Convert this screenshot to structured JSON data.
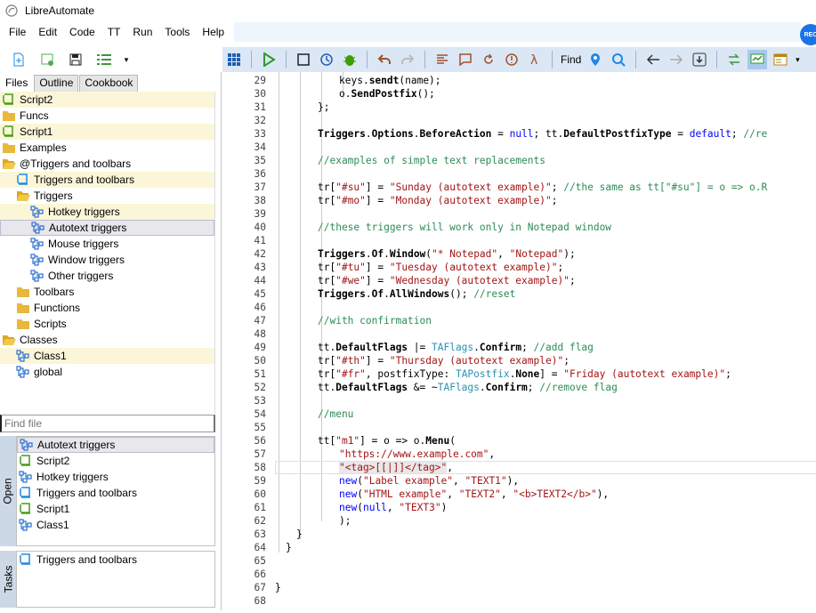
{
  "app": {
    "title": "LibreAutomate"
  },
  "menu": [
    "File",
    "Edit",
    "Code",
    "TT",
    "Run",
    "Tools",
    "Help"
  ],
  "toolbar": {
    "find_label": "Find"
  },
  "avatar_text": "REC",
  "tabs": [
    "Files",
    "Outline",
    "Cookbook"
  ],
  "files_tree": [
    {
      "label": "Script2",
      "indent": 0,
      "icon": "script-icon",
      "hl": true
    },
    {
      "label": "Funcs",
      "indent": 0,
      "icon": "folder-icon",
      "hl": false
    },
    {
      "label": "Script1",
      "indent": 0,
      "icon": "script-icon",
      "hl": true
    },
    {
      "label": "Examples",
      "indent": 0,
      "icon": "folder-icon",
      "hl": false
    },
    {
      "label": "@Triggers and toolbars",
      "indent": 0,
      "icon": "folder-open-icon",
      "hl": false
    },
    {
      "label": "Triggers and toolbars",
      "indent": 1,
      "icon": "script-blue-icon",
      "hl": true
    },
    {
      "label": "Triggers",
      "indent": 1,
      "icon": "folder-open-icon",
      "hl": false
    },
    {
      "label": "Hotkey triggers",
      "indent": 2,
      "icon": "class-icon",
      "hl": true
    },
    {
      "label": "Autotext triggers",
      "indent": 2,
      "icon": "class-icon",
      "sel": true
    },
    {
      "label": "Mouse triggers",
      "indent": 2,
      "icon": "class-icon",
      "hl": false
    },
    {
      "label": "Window triggers",
      "indent": 2,
      "icon": "class-icon",
      "hl": false
    },
    {
      "label": "Other triggers",
      "indent": 2,
      "icon": "class-icon",
      "hl": false
    },
    {
      "label": "Toolbars",
      "indent": 1,
      "icon": "folder-icon",
      "hl": false
    },
    {
      "label": "Functions",
      "indent": 1,
      "icon": "folder-icon",
      "hl": false
    },
    {
      "label": "Scripts",
      "indent": 1,
      "icon": "folder-icon",
      "hl": false
    },
    {
      "label": "Classes",
      "indent": 0,
      "icon": "folder-open-icon",
      "hl": false
    },
    {
      "label": "Class1",
      "indent": 1,
      "icon": "class-icon",
      "hl": true
    },
    {
      "label": "global",
      "indent": 1,
      "icon": "class-icon",
      "hl": false
    }
  ],
  "find_file_placeholder": "Find file",
  "open_label": "Open",
  "tasks_label": "Tasks",
  "open_files": [
    {
      "label": "Autotext triggers",
      "icon": "class-icon",
      "sel": true
    },
    {
      "label": "Script2",
      "icon": "script-icon"
    },
    {
      "label": "Hotkey triggers",
      "icon": "class-icon"
    },
    {
      "label": "Triggers and toolbars",
      "icon": "script-blue-icon"
    },
    {
      "label": "Script1",
      "icon": "script-icon"
    },
    {
      "label": "Class1",
      "icon": "class-icon"
    }
  ],
  "tasks": [
    {
      "label": "Triggers and toolbars",
      "icon": "script-blue-icon"
    }
  ],
  "code_lines": [
    {
      "n": "29",
      "ind": 3,
      "parts": [
        [
          "p",
          "keys."
        ],
        [
          "k",
          "sendt"
        ],
        [
          "p",
          "(name);"
        ]
      ]
    },
    {
      "n": "30",
      "ind": 3,
      "parts": [
        [
          "p",
          "o."
        ],
        [
          "k",
          "SendPostfix"
        ],
        [
          "p",
          "();"
        ]
      ]
    },
    {
      "n": "31",
      "ind": 2,
      "parts": [
        [
          "p",
          "};"
        ]
      ]
    },
    {
      "n": "32",
      "ind": 0,
      "parts": []
    },
    {
      "n": "33",
      "ind": 2,
      "parts": [
        [
          "k",
          "Triggers"
        ],
        [
          "p",
          "."
        ],
        [
          "k",
          "Options"
        ],
        [
          "p",
          "."
        ],
        [
          "k",
          "BeforeAction"
        ],
        [
          "p",
          " = "
        ],
        [
          "v",
          "null"
        ],
        [
          "p",
          "; tt."
        ],
        [
          "k",
          "DefaultPostfixType"
        ],
        [
          "p",
          " = "
        ],
        [
          "v",
          "default"
        ],
        [
          "p",
          "; "
        ],
        [
          "c",
          "//re"
        ]
      ]
    },
    {
      "n": "34",
      "ind": 0,
      "parts": []
    },
    {
      "n": "35",
      "ind": 2,
      "parts": [
        [
          "c",
          "//examples of simple text replacements"
        ]
      ]
    },
    {
      "n": "36",
      "ind": 0,
      "parts": []
    },
    {
      "n": "37",
      "ind": 2,
      "parts": [
        [
          "p",
          "tr["
        ],
        [
          "s",
          "\"#su\""
        ],
        [
          "p",
          "] = "
        ],
        [
          "s",
          "\"Sunday (autotext example)\""
        ],
        [
          "p",
          "; "
        ],
        [
          "c",
          "//the same as tt[\"#su\"] = o => o.R"
        ]
      ]
    },
    {
      "n": "38",
      "ind": 2,
      "parts": [
        [
          "p",
          "tr["
        ],
        [
          "s",
          "\"#mo\""
        ],
        [
          "p",
          "] = "
        ],
        [
          "s",
          "\"Monday (autotext example)\""
        ],
        [
          "p",
          ";"
        ]
      ]
    },
    {
      "n": "39",
      "ind": 0,
      "parts": []
    },
    {
      "n": "40",
      "ind": 2,
      "parts": [
        [
          "c",
          "//these triggers will work only in Notepad window"
        ]
      ]
    },
    {
      "n": "41",
      "ind": 0,
      "parts": []
    },
    {
      "n": "42",
      "ind": 2,
      "parts": [
        [
          "k",
          "Triggers"
        ],
        [
          "p",
          "."
        ],
        [
          "k",
          "Of"
        ],
        [
          "p",
          "."
        ],
        [
          "k",
          "Window"
        ],
        [
          "p",
          "("
        ],
        [
          "s",
          "\"* Notepad\""
        ],
        [
          "p",
          ", "
        ],
        [
          "s",
          "\"Notepad\""
        ],
        [
          "p",
          ");"
        ]
      ]
    },
    {
      "n": "43",
      "ind": 2,
      "parts": [
        [
          "p",
          "tr["
        ],
        [
          "s",
          "\"#tu\""
        ],
        [
          "p",
          "] = "
        ],
        [
          "s",
          "\"Tuesday (autotext example)\""
        ],
        [
          "p",
          ";"
        ]
      ]
    },
    {
      "n": "44",
      "ind": 2,
      "parts": [
        [
          "p",
          "tr["
        ],
        [
          "s",
          "\"#we\""
        ],
        [
          "p",
          "] = "
        ],
        [
          "s",
          "\"Wednesday (autotext example)\""
        ],
        [
          "p",
          ";"
        ]
      ]
    },
    {
      "n": "45",
      "ind": 2,
      "parts": [
        [
          "k",
          "Triggers"
        ],
        [
          "p",
          "."
        ],
        [
          "k",
          "Of"
        ],
        [
          "p",
          "."
        ],
        [
          "k",
          "AllWindows"
        ],
        [
          "p",
          "(); "
        ],
        [
          "c",
          "//reset"
        ]
      ]
    },
    {
      "n": "46",
      "ind": 0,
      "parts": []
    },
    {
      "n": "47",
      "ind": 2,
      "parts": [
        [
          "c",
          "//with confirmation"
        ]
      ]
    },
    {
      "n": "48",
      "ind": 0,
      "parts": []
    },
    {
      "n": "49",
      "ind": 2,
      "parts": [
        [
          "p",
          "tt."
        ],
        [
          "k",
          "DefaultFlags"
        ],
        [
          "p",
          " |= "
        ],
        [
          "t",
          "TAFlags"
        ],
        [
          "p",
          "."
        ],
        [
          "k",
          "Confirm"
        ],
        [
          "p",
          "; "
        ],
        [
          "c",
          "//add flag"
        ]
      ]
    },
    {
      "n": "50",
      "ind": 2,
      "parts": [
        [
          "p",
          "tr["
        ],
        [
          "s",
          "\"#th\""
        ],
        [
          "p",
          "] = "
        ],
        [
          "s",
          "\"Thursday (autotext example)\""
        ],
        [
          "p",
          ";"
        ]
      ]
    },
    {
      "n": "51",
      "ind": 2,
      "parts": [
        [
          "p",
          "tr["
        ],
        [
          "s",
          "\"#fr\""
        ],
        [
          "p",
          ", postfixType: "
        ],
        [
          "t",
          "TAPostfix"
        ],
        [
          "p",
          "."
        ],
        [
          "k",
          "None"
        ],
        [
          "p",
          "] = "
        ],
        [
          "s",
          "\"Friday (autotext example)\""
        ],
        [
          "p",
          ";"
        ]
      ]
    },
    {
      "n": "52",
      "ind": 2,
      "parts": [
        [
          "p",
          "tt."
        ],
        [
          "k",
          "DefaultFlags"
        ],
        [
          "p",
          " &= ~"
        ],
        [
          "t",
          "TAFlags"
        ],
        [
          "p",
          "."
        ],
        [
          "k",
          "Confirm"
        ],
        [
          "p",
          "; "
        ],
        [
          "c",
          "//remove flag"
        ]
      ]
    },
    {
      "n": "53",
      "ind": 0,
      "parts": []
    },
    {
      "n": "54",
      "ind": 2,
      "parts": [
        [
          "c",
          "//menu"
        ]
      ]
    },
    {
      "n": "55",
      "ind": 0,
      "parts": []
    },
    {
      "n": "56",
      "ind": 2,
      "parts": [
        [
          "p",
          "tt["
        ],
        [
          "s",
          "\"m1\""
        ],
        [
          "p",
          "] = o => o."
        ],
        [
          "k",
          "Menu"
        ],
        [
          "p",
          "("
        ]
      ]
    },
    {
      "n": "57",
      "ind": 3,
      "parts": [
        [
          "s",
          "\"https://www.example.com\""
        ],
        [
          "p",
          ","
        ]
      ]
    },
    {
      "n": "58",
      "ind": 3,
      "parts": [
        [
          "s",
          "\"<tag>[[|]]</tag>\""
        ],
        [
          "p",
          ","
        ]
      ]
    },
    {
      "n": "59",
      "ind": 3,
      "parts": [
        [
          "v",
          "new"
        ],
        [
          "p",
          "("
        ],
        [
          "s",
          "\"Label example\""
        ],
        [
          "p",
          ", "
        ],
        [
          "s",
          "\"TEXT1\""
        ],
        [
          "p",
          "),"
        ]
      ]
    },
    {
      "n": "60",
      "ind": 3,
      "parts": [
        [
          "v",
          "new"
        ],
        [
          "p",
          "("
        ],
        [
          "s",
          "\"HTML example\""
        ],
        [
          "p",
          ", "
        ],
        [
          "s",
          "\"TEXT2\""
        ],
        [
          "p",
          ", "
        ],
        [
          "s",
          "\"<b>TEXT2</b>\""
        ],
        [
          "p",
          "),"
        ]
      ]
    },
    {
      "n": "61",
      "ind": 3,
      "parts": [
        [
          "v",
          "new"
        ],
        [
          "p",
          "("
        ],
        [
          "v",
          "null"
        ],
        [
          "p",
          ", "
        ],
        [
          "s",
          "\"TEXT3\""
        ],
        [
          "p",
          ")"
        ]
      ]
    },
    {
      "n": "62",
      "ind": 3,
      "parts": [
        [
          "p",
          ");"
        ]
      ]
    },
    {
      "n": "63",
      "ind": 1,
      "parts": [
        [
          "p",
          "}"
        ]
      ]
    },
    {
      "n": "64",
      "ind": 0.5,
      "parts": [
        [
          "p",
          "}"
        ]
      ]
    },
    {
      "n": "65",
      "ind": 0,
      "parts": []
    },
    {
      "n": "66",
      "ind": 0,
      "parts": []
    },
    {
      "n": "67",
      "ind": 0,
      "parts": [
        [
          "p",
          "}"
        ]
      ]
    },
    {
      "n": "68",
      "ind": 0,
      "parts": []
    }
  ]
}
